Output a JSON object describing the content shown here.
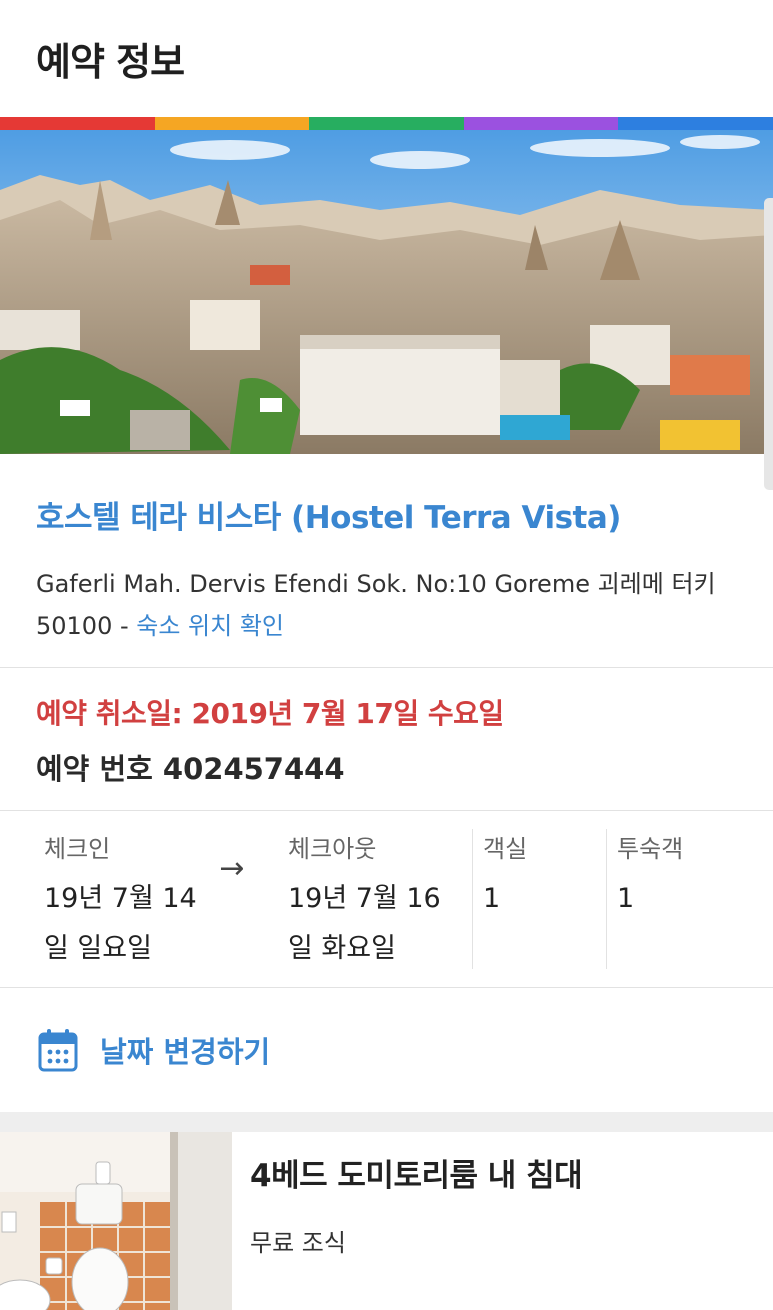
{
  "header": {
    "title": "예약 정보"
  },
  "colors": {
    "accent": "#3a86d0",
    "alert": "#d14040",
    "rainbow": [
      "#e53935",
      "#f5a623",
      "#27ae60",
      "#9b51e0",
      "#2d7fe0"
    ]
  },
  "hotel": {
    "name": "호스텔 테라 비스타 (Hostel Terra Vista)",
    "address": "Gaferli Mah. Dervis Efendi Sok. No:10 Goreme 괴레메 터키 50100 - ",
    "map_link": "숙소 위치 확인"
  },
  "booking": {
    "cancel_date": "예약 취소일: 2019년 7월 17일 수요일",
    "number": "예약 번호 402457444"
  },
  "stay": {
    "checkin_label": "체크인",
    "checkin_value_line1": "19년 7월 14",
    "checkin_value_line2": "일 일요일",
    "arrow": "→",
    "checkout_label": "체크아웃",
    "checkout_value_line1": "19년 7월 16",
    "checkout_value_line2": "일 화요일",
    "rooms_label": "객실",
    "rooms_value": "1",
    "guests_label": "투숙객",
    "guests_value": "1"
  },
  "actions": {
    "change_dates": "날짜 변경하기",
    "change_icon": "calendar-icon"
  },
  "room": {
    "name": "4베드 도미토리룸 내 침대",
    "board": "무료 조식"
  }
}
